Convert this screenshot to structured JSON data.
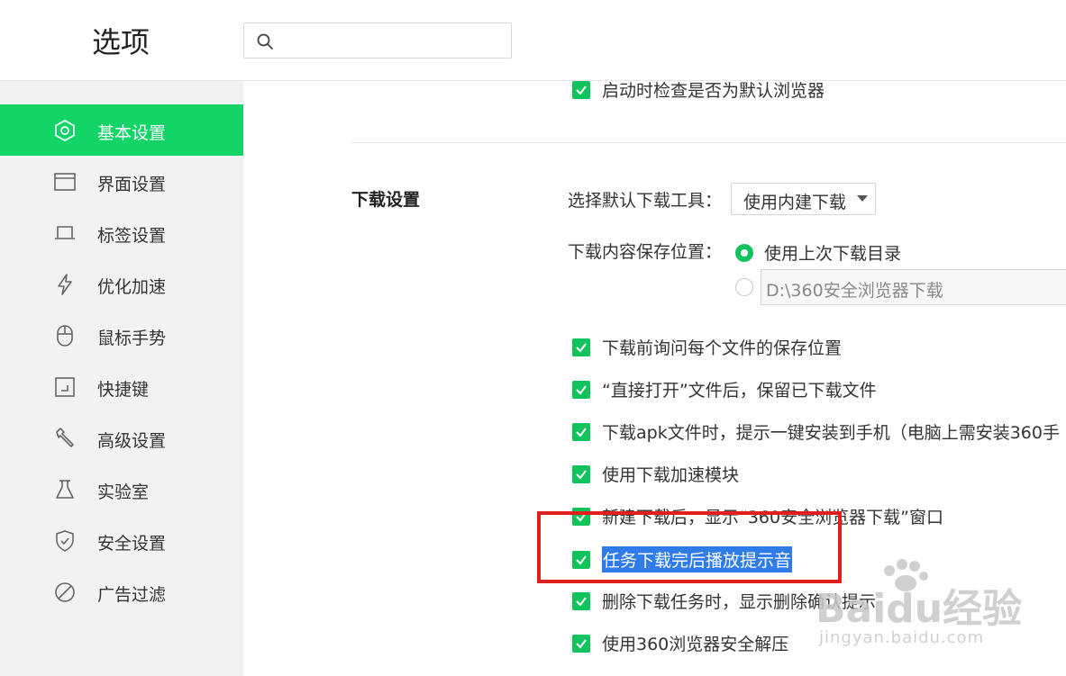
{
  "header": {
    "title": "选项",
    "search": {
      "placeholder": "",
      "value": ""
    }
  },
  "sidebar": {
    "items": [
      {
        "label": "基本设置",
        "icon": "gear-hex-icon",
        "active": true
      },
      {
        "label": "界面设置",
        "icon": "window-icon",
        "active": false
      },
      {
        "label": "标签设置",
        "icon": "tab-icon",
        "active": false
      },
      {
        "label": "优化加速",
        "icon": "lightning-icon",
        "active": false
      },
      {
        "label": "鼠标手势",
        "icon": "mouse-icon",
        "active": false
      },
      {
        "label": "快捷键",
        "icon": "shortcut-icon",
        "active": false
      },
      {
        "label": "高级设置",
        "icon": "wrench-icon",
        "active": false
      },
      {
        "label": "实验室",
        "icon": "flask-icon",
        "active": false
      },
      {
        "label": "安全设置",
        "icon": "shield-icon",
        "active": false
      },
      {
        "label": "广告过滤",
        "icon": "block-icon",
        "active": false
      }
    ]
  },
  "content": {
    "top_option": {
      "label": "启动时检查是否为默认浏览器",
      "checked": true
    },
    "download": {
      "section_title": "下载设置",
      "tool_label": "选择默认下载工具：",
      "tool_value": "使用内建下载",
      "location_label": "下载内容保存位置：",
      "location_option_last": "使用上次下载目录",
      "location_path": "D:\\360安全浏览器下载",
      "options": [
        {
          "label": "下载前询问每个文件的保存位置",
          "checked": true
        },
        {
          "label": "“直接打开”文件后，保留已下载文件",
          "checked": true
        },
        {
          "label": "下载apk文件时，提示一键安装到手机（电脑上需安装360手",
          "checked": true
        },
        {
          "label": "使用下载加速模块",
          "checked": true
        },
        {
          "label": "新建下载后，显示“360安全浏览器下载”窗口",
          "checked": true
        },
        {
          "label": "任务下载完后播放提示音",
          "checked": true,
          "highlighted": true
        },
        {
          "label": "删除下载任务时，显示删除确认提示",
          "checked": true
        },
        {
          "label": "使用360浏览器安全解压",
          "checked": true
        }
      ]
    }
  },
  "watermark": {
    "brand": "Baidu经验",
    "url": "jingyan.baidu.com"
  },
  "colors": {
    "accent": "#12d467",
    "checkbox": "#12c35d",
    "highlight": "#2f7be8",
    "annotation": "#e0201e"
  }
}
